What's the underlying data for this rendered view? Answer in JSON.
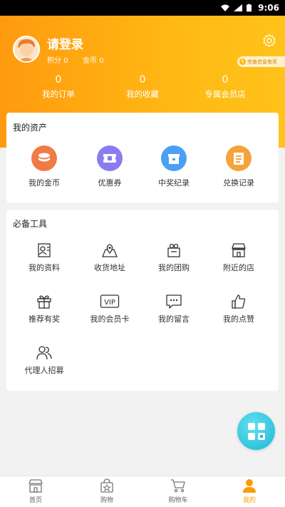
{
  "status_bar": {
    "time": "9:06"
  },
  "profile": {
    "login_text": "请登录",
    "points_label": "积分",
    "points_value": "0",
    "coins_label": "金币",
    "coins_value": "0",
    "badge_text": "完善信息有奖"
  },
  "stats": [
    {
      "value": "0",
      "label": "我的订单"
    },
    {
      "value": "0",
      "label": "我的收藏"
    },
    {
      "value": "0",
      "label": "专属会员店"
    }
  ],
  "assets": {
    "title": "我的资产",
    "items": [
      {
        "label": "我的金币",
        "icon": "coins-icon",
        "color": "#f07a45"
      },
      {
        "label": "优惠券",
        "icon": "ticket-icon",
        "color": "#8a7cf0"
      },
      {
        "label": "中奖纪录",
        "icon": "gift-box-icon",
        "color": "#4aa0f2"
      },
      {
        "label": "兑换记录",
        "icon": "clipboard-icon",
        "color": "#f5a33a"
      }
    ]
  },
  "tools": {
    "title": "必备工具",
    "items": [
      {
        "label": "我的资料",
        "icon": "profile-card-icon"
      },
      {
        "label": "收货地址",
        "icon": "map-location-icon"
      },
      {
        "label": "我的团购",
        "icon": "group-buy-icon"
      },
      {
        "label": "附近的店",
        "icon": "store-icon"
      },
      {
        "label": "推荐有奖",
        "icon": "gift-icon"
      },
      {
        "label": "我的会员卡",
        "icon": "vip-card-icon",
        "vip_text": "VIP"
      },
      {
        "label": "我的留言",
        "icon": "message-icon"
      },
      {
        "label": "我的点赞",
        "icon": "thumbs-up-icon"
      },
      {
        "label": "代理人招募",
        "icon": "people-icon"
      }
    ]
  },
  "tabbar": {
    "items": [
      {
        "label": "首页",
        "icon": "home-store-icon"
      },
      {
        "label": "购物",
        "icon": "shopping-bag-icon"
      },
      {
        "label": "购物车",
        "icon": "cart-icon"
      },
      {
        "label": "我的",
        "icon": "user-icon",
        "active": true
      }
    ]
  },
  "colors": {
    "accent": "#ff9a00",
    "header_start": "#ff9a0f",
    "header_end": "#ffc31a",
    "fab": "#1fb8d4"
  }
}
